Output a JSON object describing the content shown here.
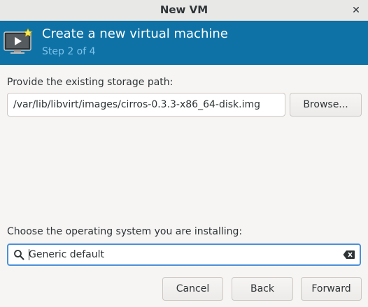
{
  "window": {
    "title": "New VM",
    "close_glyph": "✕"
  },
  "header": {
    "title": "Create a new virtual machine",
    "step": "Step 2 of 4",
    "icon": "virtual-machine-monitor-icon",
    "background_color": "#0e72a6"
  },
  "storage": {
    "label": "Provide the existing storage path:",
    "path_value": "/var/lib/libvirt/images/cirros-0.3.3-x86_64-disk.img",
    "browse_label": "Browse..."
  },
  "os": {
    "label": "Choose the operating system you are installing:",
    "search_value": "Generic default",
    "search_icon": "search-icon",
    "clear_icon": "clear-text-icon"
  },
  "footer": {
    "cancel_label": "Cancel",
    "back_label": "Back",
    "forward_label": "Forward"
  }
}
